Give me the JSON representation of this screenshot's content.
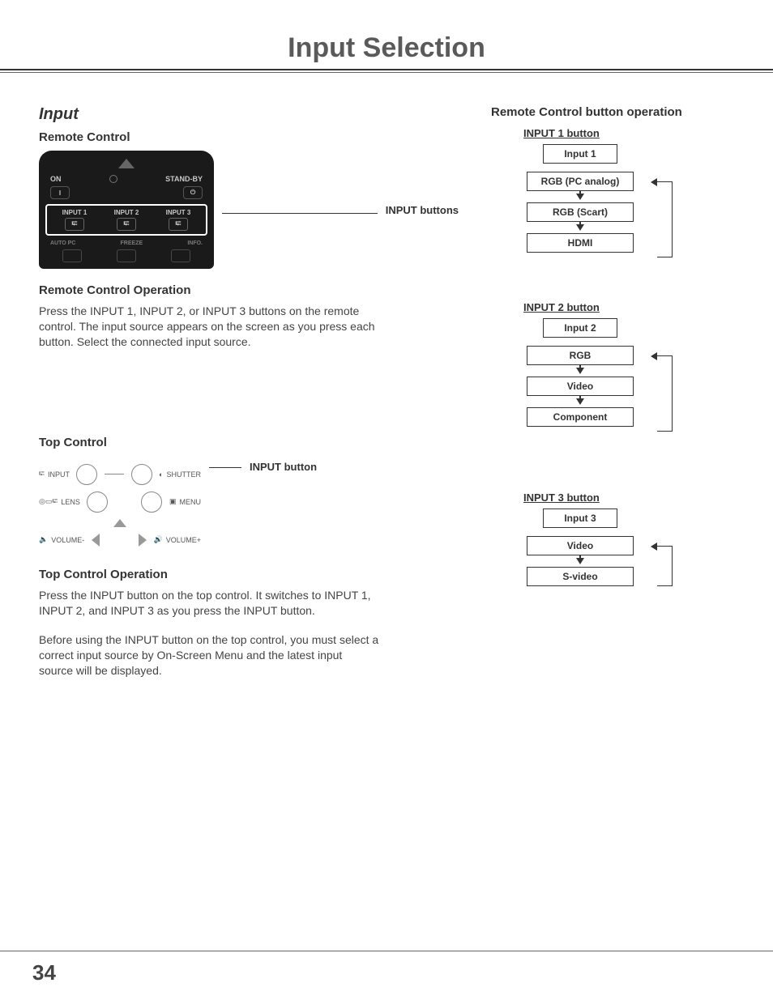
{
  "page_title": "Input Selection",
  "page_number": "34",
  "section_heading": "Input",
  "left": {
    "remote_heading": "Remote Control",
    "remote_callout": "INPUT buttons",
    "remote_labels": {
      "on": "ON",
      "standby": "STAND-BY",
      "input1": "INPUT 1",
      "input2": "INPUT 2",
      "input3": "INPUT 3",
      "autopc": "AUTO PC",
      "freeze": "FREEZE",
      "info": "INFO."
    },
    "remote_op_heading": "Remote Control Operation",
    "remote_op_text": "Press the INPUT 1, INPUT 2, or INPUT 3 buttons on the remote control. The input source appears on the screen as you press each button. Select the connected input source.",
    "top_heading": "Top Control",
    "top_callout": "INPUT button",
    "top_labels": {
      "input": "INPUT",
      "shutter": "SHUTTER",
      "lens": "LENS",
      "menu": "MENU",
      "vol_minus": "VOLUME-",
      "vol_plus": "VOLUME+"
    },
    "top_op_heading": "Top Control Operation",
    "top_op_text1": "Press the INPUT button on the top control. It switches to INPUT 1, INPUT 2, and INPUT 3 as you press the INPUT button.",
    "top_op_text2": "Before using the INPUT button on the top control, you must select a correct input source by On-Screen Menu and the latest input source will be displayed."
  },
  "right": {
    "heading": "Remote Control button operation",
    "flow1": {
      "title": "INPUT 1 button",
      "head": "Input 1",
      "items": [
        "RGB (PC analog)",
        "RGB (Scart)",
        "HDMI"
      ]
    },
    "flow2": {
      "title": "INPUT 2 button",
      "head": "Input 2",
      "items": [
        "RGB",
        "Video",
        "Component"
      ]
    },
    "flow3": {
      "title": "INPUT 3 button",
      "head": "Input 3",
      "items": [
        "Video",
        "S-video"
      ]
    }
  }
}
